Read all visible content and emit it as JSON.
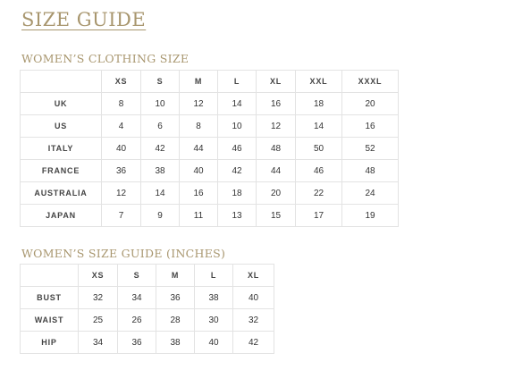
{
  "title": "SIZE GUIDE",
  "clothing": {
    "heading": "WOMEN’S CLOTHING SIZE",
    "columns": [
      "",
      "XS",
      "S",
      "M",
      "L",
      "XL",
      "XXL",
      "XXXL"
    ],
    "rows": [
      {
        "label": "UK",
        "values": [
          "8",
          "10",
          "12",
          "14",
          "16",
          "18",
          "20"
        ]
      },
      {
        "label": "US",
        "values": [
          "4",
          "6",
          "8",
          "10",
          "12",
          "14",
          "16"
        ]
      },
      {
        "label": "ITALY",
        "values": [
          "40",
          "42",
          "44",
          "46",
          "48",
          "50",
          "52"
        ]
      },
      {
        "label": "FRANCE",
        "values": [
          "36",
          "38",
          "40",
          "42",
          "44",
          "46",
          "48"
        ]
      },
      {
        "label": "AUSTRALIA",
        "values": [
          "12",
          "14",
          "16",
          "18",
          "20",
          "22",
          "24"
        ]
      },
      {
        "label": "JAPAN",
        "values": [
          "7",
          "9",
          "11",
          "13",
          "15",
          "17",
          "19"
        ]
      }
    ]
  },
  "inches": {
    "heading": "WOMEN’S SIZE GUIDE (INCHES)",
    "columns": [
      "",
      "XS",
      "S",
      "M",
      "L",
      "XL"
    ],
    "rows": [
      {
        "label": "BUST",
        "values": [
          "32",
          "34",
          "36",
          "38",
          "40"
        ]
      },
      {
        "label": "WAIST",
        "values": [
          "25",
          "26",
          "28",
          "30",
          "32"
        ]
      },
      {
        "label": "HIP",
        "values": [
          "34",
          "36",
          "38",
          "40",
          "42"
        ]
      }
    ]
  },
  "colors": {
    "accent": "#a8966e",
    "border": "#e3e3e3",
    "text": "#333333"
  }
}
